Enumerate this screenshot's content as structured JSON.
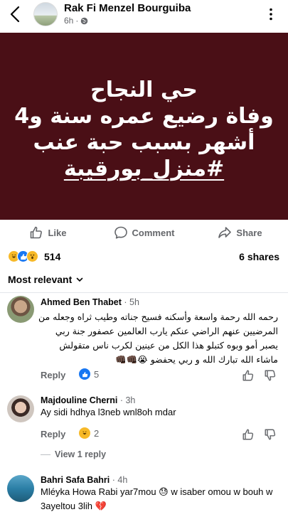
{
  "header": {
    "page_name": "Rak Fi Menzel Bourguiba",
    "time": "6h",
    "separator": "·",
    "privacy_icon": "globe-icon"
  },
  "banner": {
    "lines": [
      "حي النجاح",
      "وفاة رضيع عمره سنة و4",
      "أشهر بسبب حبة عنب",
      "#منزل_بورقيبة"
    ],
    "background": "#4a0f16"
  },
  "actions": {
    "like": "Like",
    "comment": "Comment",
    "share": "Share"
  },
  "stats": {
    "reactions_count": "514",
    "shares": "6 shares",
    "reaction_icons": [
      "haha-icon",
      "like-icon",
      "wow-icon"
    ]
  },
  "sort": {
    "label": "Most relevant"
  },
  "comments": [
    {
      "name": "Ahmed Ben Thabet",
      "time": "5h",
      "text": "رحمه الله رحمة واسعة وأسكنه فسيح جناته وطيب ثراه وجعله من المرضيين عنهم الراضي عنكم يارب العالمين عصفور جنة ربي يصبر أمو وبوه كتبلو هذا الكل من عينين لكرب ناس متقولش ماشاء الله تبارك الله و ربي يحفضو 😭👊🏿👊🏿",
      "reply": "Reply",
      "reaction_count": "5"
    },
    {
      "name": "Majdouline Cherni",
      "time": "3h",
      "text": "Ay sidi hdhya l3neb wnl8oh mdar",
      "reply": "Reply",
      "reaction_count": "2",
      "view_replies": "View 1 reply"
    },
    {
      "name": "Bahri Safa Bahri",
      "time": "4h",
      "text": "Mléyka Howa Rabi yar7mou 😓 w isaber omou w bouh w 3ayeltou 3lih 💔"
    }
  ],
  "colors": {
    "accent_like": "#1877f2",
    "secondary_text": "#65676b"
  }
}
